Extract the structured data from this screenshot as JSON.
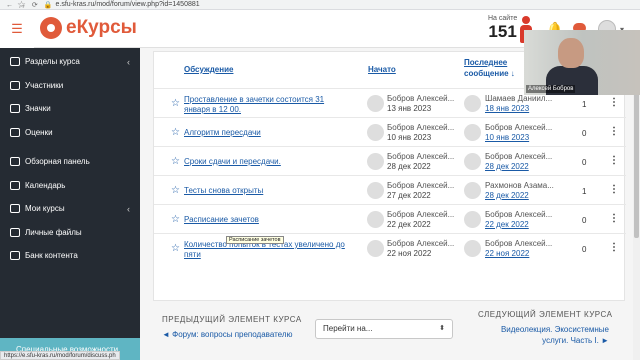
{
  "browser": {
    "url": "e.sfu-kras.ru/mod/forum/view.php?id=1450881"
  },
  "header": {
    "logo_text": "eКурсы",
    "online_label": "На сайте",
    "online_count": "151"
  },
  "video": {
    "participant_name": "Алексей Бобров"
  },
  "sidebar": {
    "items": [
      {
        "label": "Разделы курса",
        "icon": "list-icon",
        "chevron": "‹"
      },
      {
        "label": "Участники",
        "icon": "users-icon",
        "chevron": ""
      },
      {
        "label": "Значки",
        "icon": "badge-icon",
        "chevron": ""
      },
      {
        "label": "Оценки",
        "icon": "grades-icon",
        "chevron": ""
      },
      {
        "label": "Обзорная панель",
        "icon": "dashboard-icon",
        "chevron": ""
      },
      {
        "label": "Календарь",
        "icon": "calendar-icon",
        "chevron": ""
      },
      {
        "label": "Мои курсы",
        "icon": "courses-icon",
        "chevron": "‹"
      },
      {
        "label": "Личные файлы",
        "icon": "files-icon",
        "chevron": ""
      },
      {
        "label": "Банк контента",
        "icon": "content-bank-icon",
        "chevron": ""
      }
    ],
    "bottom_label": "Специальные возможности",
    "status_url": "https://e.sfu-kras.ru/mod/forum/discuss.ph"
  },
  "table": {
    "headers": {
      "discussion": "Обсуждение",
      "started": "Начато",
      "last_post_line1": "Последнее",
      "last_post_line2": "сообщение ↓"
    },
    "rows": [
      {
        "topic": "Проставление в зачетки состоится 31 января в 12 00.",
        "author": "Бобров Алексей...",
        "started": "13 янв 2023",
        "last_author": "Шамаев Даниил...",
        "last_date": "18 янв 2023",
        "replies": "1"
      },
      {
        "topic": "Алгоритм пересдачи",
        "author": "Бобров Алексей...",
        "started": "10 янв 2023",
        "last_author": "Бобров Алексей...",
        "last_date": "10 янв 2023",
        "replies": "0"
      },
      {
        "topic": "Сроки сдачи и пересдачи.",
        "author": "Бобров Алексей...",
        "started": "28 дек 2022",
        "last_author": "Бобров Алексей...",
        "last_date": "28 дек 2022",
        "replies": "0"
      },
      {
        "topic": "Тесты снова открыты",
        "author": "Бобров Алексей...",
        "started": "27 дек 2022",
        "last_author": "Рахмонов Азама...",
        "last_date": "28 дек 2022",
        "replies": "1"
      },
      {
        "topic": "Расписание зачетов",
        "author": "Бобров Алексей...",
        "started": "22 дек 2022",
        "last_author": "Бобров Алексей...",
        "last_date": "22 дек 2022",
        "replies": "0"
      },
      {
        "topic": "Количество попыток в тестах увеличено до пяти",
        "author": "Бобров Алексей...",
        "started": "22 ноя 2022",
        "last_author": "Бобров Алексей...",
        "last_date": "22 ноя 2022",
        "replies": "0"
      }
    ],
    "tooltip": "Расписание зачетов"
  },
  "footer": {
    "prev_label": "ПРЕДЫДУЩИЙ ЭЛЕМЕНТ КУРСА",
    "prev_link": "◄ Форум: вопросы преподавателю",
    "select_value": "Перейти на...",
    "next_label": "СЛЕДУЮЩИЙ ЭЛЕМЕНТ КУРСА",
    "next_link": "Видеолекция. Экосистемные услуги. Часть I. ►"
  },
  "colors": {
    "brand": "#e05a3a",
    "sidebar_bg": "#252b33",
    "link": "#1a5aa6",
    "accessibility_bar": "#5fb5c3"
  }
}
